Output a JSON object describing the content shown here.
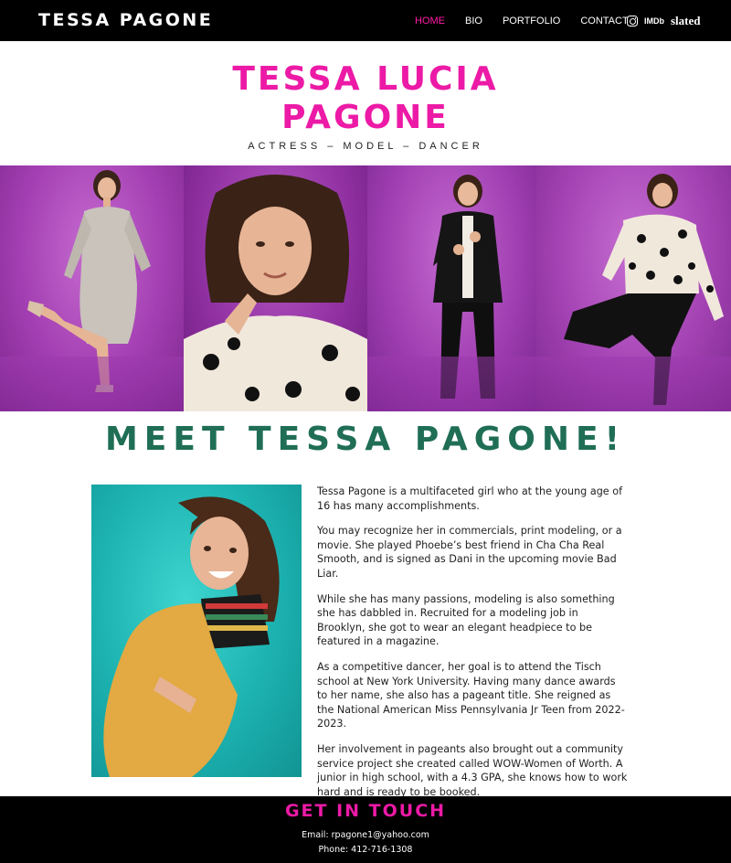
{
  "header": {
    "brand": "TESSA PAGONE",
    "nav": [
      "HOME",
      "BIO",
      "PORTFOLIO",
      "CONTACT"
    ],
    "active": "HOME",
    "social": [
      {
        "icon": "instagram-icon",
        "label": ""
      },
      {
        "icon": "imdb-icon",
        "label": "IMDb"
      },
      {
        "icon": "slated-icon",
        "label": "slated"
      }
    ]
  },
  "hero": {
    "title_line1": "TESSA LUCIA",
    "title_line2": "PAGONE",
    "subtitle": "ACTRESS – MODEL – DANCER",
    "title_color": "#ec1aa6"
  },
  "gallery": {
    "photos": [
      {
        "name": "sequin-dress-photo"
      },
      {
        "name": "headshot-photo"
      },
      {
        "name": "black-blazer-photo"
      },
      {
        "name": "polka-dot-photo"
      }
    ],
    "background_color": "#a43fb3"
  },
  "about": {
    "heading": "MEET TESSA PAGONE!",
    "heading_color": "#1f6e55",
    "paragraphs": [
      "Tessa Pagone is a multifaceted girl who at the young age of 16 has many accomplishments.",
      "You may recognize her in commercials, print modeling, or a movie. She played Phoebe’s best friend in Cha Cha Real Smooth, and is signed as Dani in the upcoming movie Bad Liar.",
      "While she has many passions, modeling is also something she has dabbled in. Recruited for a modeling job in Brooklyn, she got to wear an elegant headpiece to be featured in a magazine.",
      "As a competitive dancer, her goal is to attend the Tisch school at New York University. Having many dance awards to her name, she also has a pageant title. She reigned as the National American Miss Pennsylvania Jr Teen from 2022-2023.",
      "Her involvement in pageants also brought out a community service project she created called WOW-Women of Worth. A junior in high school, with a 4.3 GPA, she knows how to work hard and is ready to be booked."
    ]
  },
  "footer": {
    "title": "GET IN TOUCH",
    "email": "Email: rpagone1@yahoo.com",
    "phone": "Phone: 412-716-1308"
  }
}
